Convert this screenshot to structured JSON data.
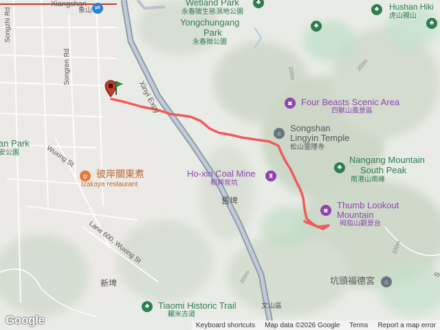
{
  "labels": {
    "xiangshan": "Xiangshan",
    "xiangshan_zh": "象山",
    "songzhi_rd": "Songzhi Rd",
    "songren_rd": "Songren Rd",
    "xinyi_expy": "Xinyi Expy",
    "wetland_park": "Wetland Park",
    "wetland_park_zh": "永春陂生態濕地公園",
    "yongchungang": "Yongchungang",
    "park": "Park",
    "yongchungang_zh": "永春崗公園",
    "hushan_hiki": "Hushan Hiki",
    "hushan_zh": "虎山親山",
    "four_beasts": "Four Beasts Scenic Area",
    "four_beasts_zh": "四獸山風景區",
    "songshan": "Songshan",
    "lingyin": "Lingyin Temple",
    "lingyin_zh": "松山靈隱寺",
    "an_park": "an Park",
    "an_park_zh": "安公園",
    "wuxing_st": "Wuxing St",
    "izakaya_zh": "彼岸關東煮",
    "izakaya": "Izakaya restaurant",
    "hoxin": "Ho-xin Coal Mine",
    "hoxin_zh": "和興炭坑",
    "nangang": "Nangang Mountain",
    "south_peak": "South Peak",
    "nangang_zh": "南港山南峰",
    "jiupi": "舊埤",
    "thumb": "Thumb Lookout",
    "mountain": "Mountain",
    "thumb_zh": "拇指山觀景台",
    "lane600": "Lane 600, Wuxing St",
    "xinpi": "新埤",
    "kengtou_zh": "坑頭福德宮",
    "tiaomi": "Tiaomi Historic Trail",
    "tiaomi_zh": "糶米古道",
    "contour_100m": "100m",
    "contour_200m_a": "200m",
    "contour_200m_b": "200m",
    "contour_200m_c": "200m",
    "wenshan_zh": "文山區",
    "s_edge": "S"
  },
  "attribution": {
    "logo": "Google",
    "shortcuts": "Keyboard shortcuts",
    "map_data": "Map data ©2026 Google",
    "terms": "Terms",
    "report": "Report a map error"
  },
  "colors": {
    "route": "#f05a5a",
    "expressway": "#8c9bab",
    "poi_green": "#2e7d4f",
    "poi_purple": "#8e44ad",
    "poi_orange": "#c0632b",
    "start_pin": "#2e8b3e",
    "end_pin": "#c0392b"
  },
  "icons": {
    "park": "tree-icon",
    "scenic": "camera-icon",
    "temple": "temple-icon",
    "restaurant": "fork-knife-icon",
    "landmark": "monument-icon",
    "start": "start-flag-icon",
    "end": "end-pin-icon"
  }
}
